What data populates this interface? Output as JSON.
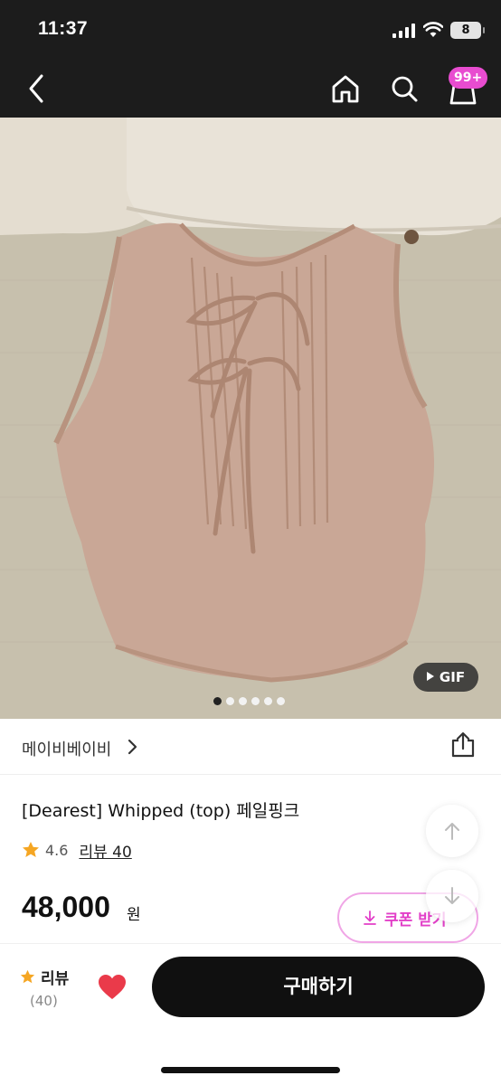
{
  "status_bar": {
    "time": "11:37",
    "battery": "8"
  },
  "nav": {
    "back_icon": "chevron-left-icon",
    "home_icon": "home-icon",
    "search_icon": "search-icon",
    "cart_icon": "shopping-bag-icon",
    "cart_badge": "99+"
  },
  "gallery": {
    "gif_label": "GIF",
    "total_images": 6,
    "active_index": 0
  },
  "seller": {
    "name": "메이비베이비",
    "share_icon": "share-icon"
  },
  "product": {
    "title": "[Dearest] Whipped (top) 페일핑크",
    "rating": "4.6",
    "review_link": "리뷰 40"
  },
  "price": {
    "amount": "48,000",
    "unit": "원"
  },
  "coupon": {
    "label": "쿠폰 받기"
  },
  "bottom_bar": {
    "review_label": "리뷰",
    "review_count": "(40)",
    "buy_label": "구매하기"
  },
  "colors": {
    "accent_pink": "#e84cd0",
    "heart_red": "#ea3a4a",
    "star_orange": "#f5a623",
    "buy_button": "#101010"
  }
}
